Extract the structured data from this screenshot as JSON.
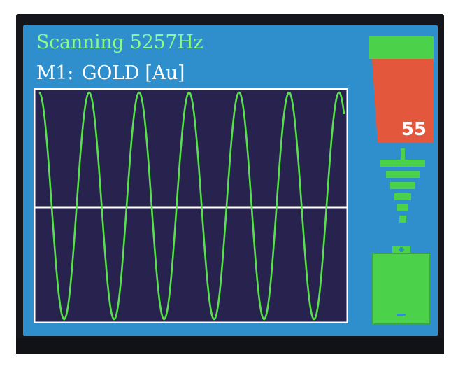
{
  "header": {
    "status_text": "Scanning 5257Hz",
    "mode_label": "M1:",
    "mode_value": "GOLD [Au]"
  },
  "signal_meter": {
    "value": "55",
    "level_fraction": 0.55,
    "colors": {
      "top": "#4cd14a",
      "fill": "#e3573c"
    }
  },
  "icons": {
    "depth": "depth-level-icon",
    "battery": "battery-icon"
  },
  "battery": {
    "level_fraction": 1.0,
    "color": "#4cd14a"
  },
  "scope": {
    "cycles": 6,
    "trace_color": "#58e04a",
    "background": "#27224e",
    "frame_color": "#ffffff"
  },
  "colors": {
    "screen": "#2f8fcc",
    "status_text": "#8dfa8a"
  }
}
